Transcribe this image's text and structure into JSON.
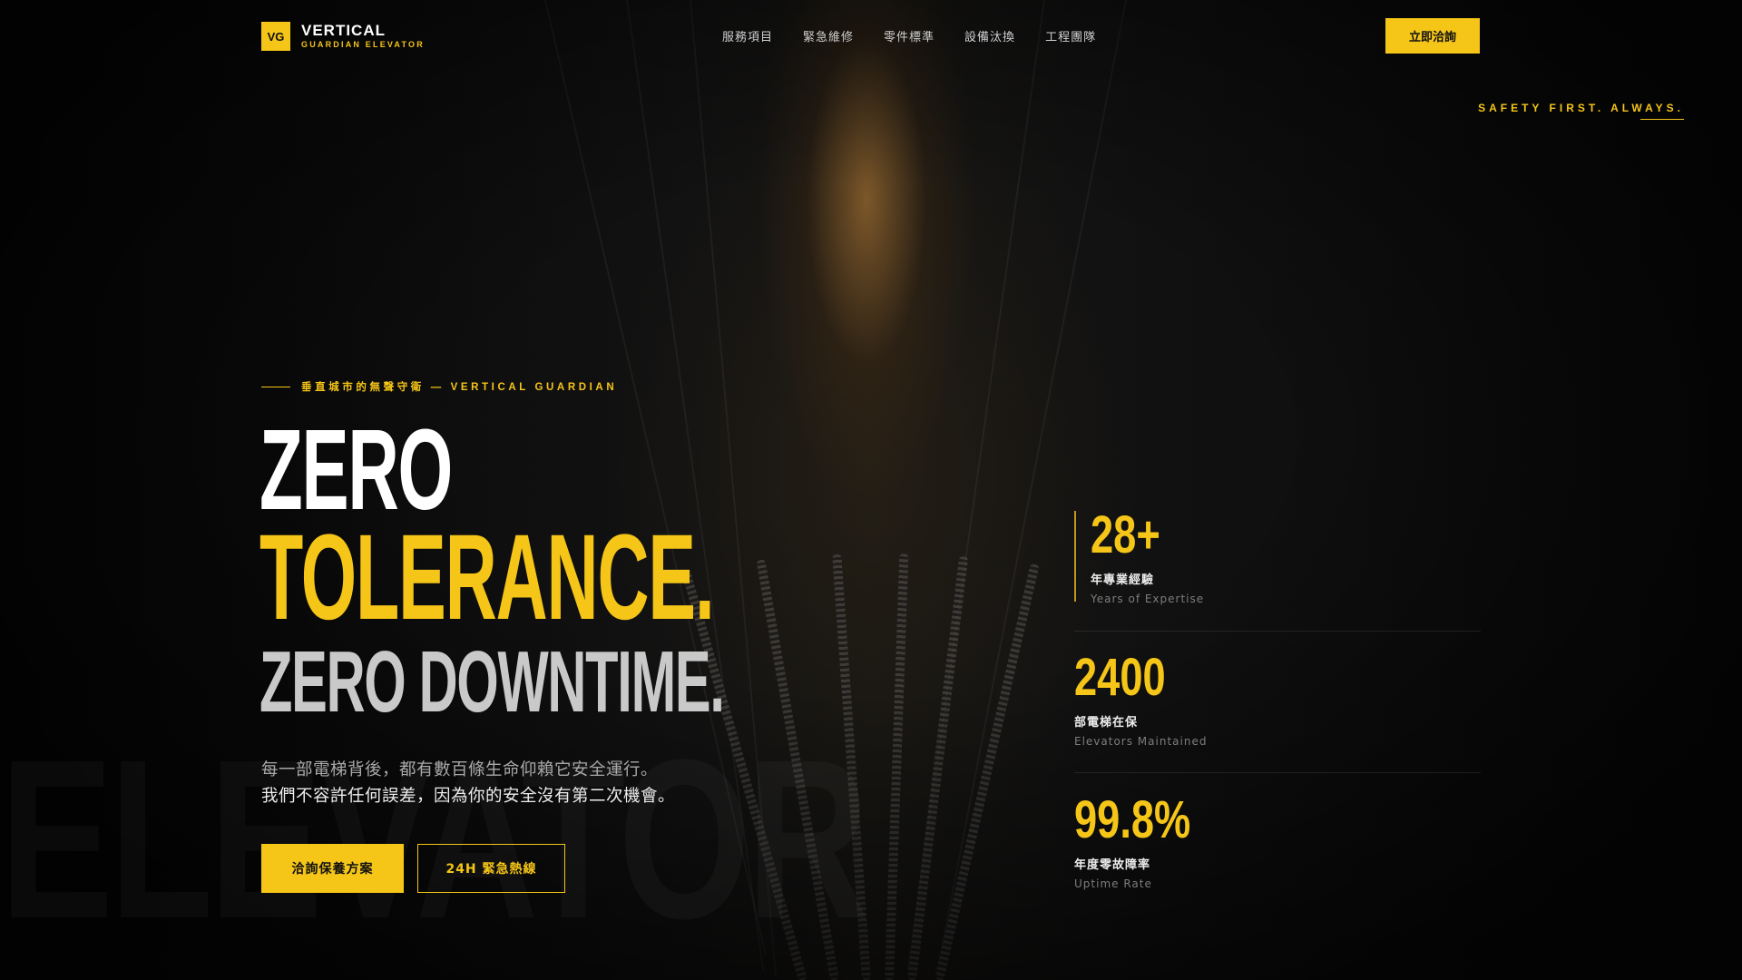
{
  "brand": {
    "badge": "VG",
    "title": "VERTICAL",
    "subtitle": "GUARDIAN ELEVATOR",
    "accent_color": "#f5c518"
  },
  "nav": {
    "items": [
      "服務項目",
      "緊急維修",
      "零件標準",
      "設備汰換",
      "工程團隊"
    ],
    "cta_label": "立即洽詢"
  },
  "tagline": "SAFETY FIRST. ALWAYS.",
  "hero": {
    "eyebrow": "垂直城市的無聲守衛 — VERTICAL GUARDIAN",
    "headline": [
      "ZERO",
      "TOLERANCE.",
      "ZERO DOWNTIME."
    ],
    "description": [
      "每一部電梯背後，都有數百條生命仰賴它安全運行。",
      "我們不容許任何誤差，因為你的安全沒有第二次機會。"
    ],
    "primary_button": "洽詢保養方案",
    "secondary_button": "24H 緊急熱線",
    "watermark": "ELEVATOR"
  },
  "stats": [
    {
      "value": "28+",
      "label_zh": "年專業經驗",
      "label_en": "Years of Expertise"
    },
    {
      "value": "2400",
      "label_zh": "部電梯在保",
      "label_en": "Elevators Maintained"
    },
    {
      "value": "99.8%",
      "label_zh": "年度零故障率",
      "label_en": "Uptime Rate"
    }
  ]
}
